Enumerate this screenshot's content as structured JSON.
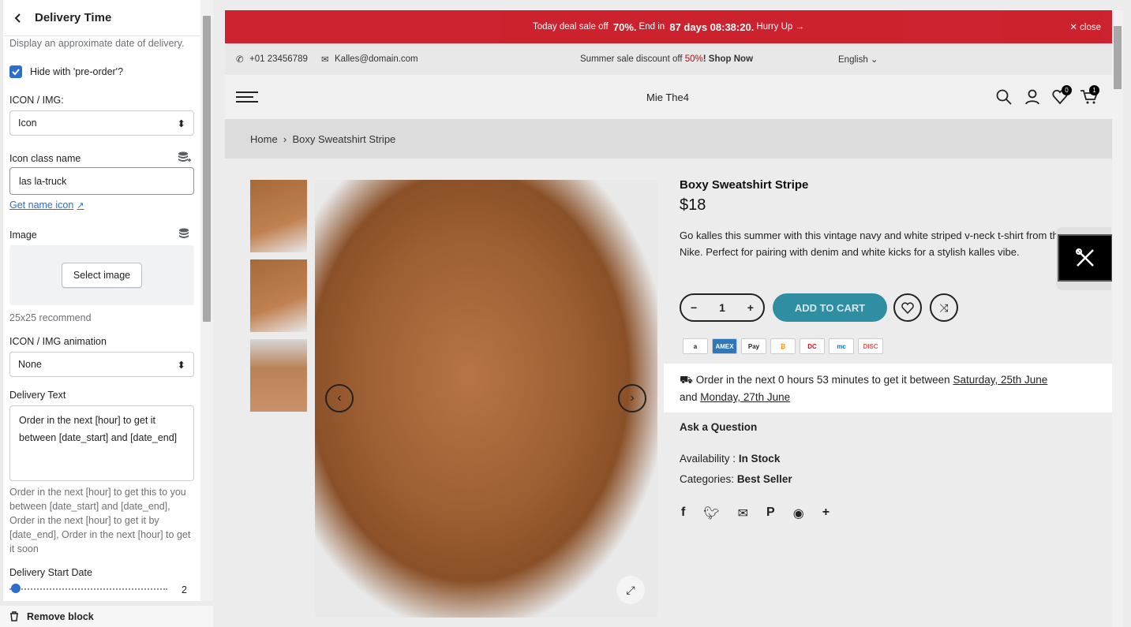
{
  "panel": {
    "title": "Delivery Time",
    "description": "Display an approximate date of delivery.",
    "hide_preorder_label": "Hide with 'pre-order'?",
    "icon_img_label": "ICON / IMG:",
    "icon_img_value": "Icon",
    "icon_class_label": "Icon class name",
    "icon_class_value": "las la-truck",
    "get_name_icon": "Get name icon",
    "image_label": "Image",
    "select_image": "Select image",
    "image_help": "25x25 recommend",
    "animation_label": "ICON / IMG animation",
    "animation_value": "None",
    "delivery_text_label": "Delivery Text",
    "delivery_text_value": "Order in the next [hour] to get it between [date_start] and [date_end]",
    "delivery_help": "Order in the next [hour] to get this to you between [date_start] and [date_end], Order in the next [hour] to get it by [date_end], Order in the next [hour] to get it soon",
    "start_date_label": "Delivery Start Date",
    "start_date_value": "2",
    "remove_block": "Remove block"
  },
  "store": {
    "announcement": {
      "pre": "Today deal sale off",
      "pct": "70%.",
      "mid": "End in",
      "timer": "87 days 08:38:20.",
      "post": "Hurry Up →",
      "close": "✕ close"
    },
    "phone": "+01 23456789",
    "email": "Kalles@domain.com",
    "promo_pre": "Summer sale discount off",
    "promo_pct": "50%",
    "promo_link": "! Shop Now",
    "language": "English ⌄",
    "logo": "Mie The4",
    "wishlist_count": "0",
    "cart_count": "1",
    "breadcrumb_home": "Home",
    "breadcrumb_sep": "›",
    "breadcrumb_current": "Boxy Sweatshirt Stripe",
    "product": {
      "title": "Boxy Sweatshirt Stripe",
      "price": "$18",
      "description": "Go kalles this summer with this vintage navy and white striped v-neck t-shirt from the Nike. Perfect for pairing with denim and white kicks for a stylish kalles vibe.",
      "qty": "1",
      "add_to_cart": "ADD TO CART",
      "delivery_pre": "Order in the next 0 hours 53 minutes to get it between",
      "date_start": "Saturday, 25th June",
      "delivery_and": "and",
      "date_end": "Monday, 27th June",
      "ask": "Ask a Question",
      "availability_label": "Availability :",
      "availability_value": "In Stock",
      "categories_label": "Categories:",
      "categories_value": "Best Seller",
      "payments": [
        "a",
        "AMEX",
        "Pay",
        "₿",
        "DC",
        "mc",
        "DISC"
      ]
    }
  },
  "colors": {
    "accent": "#2c6ecb",
    "announcement": "#c8000f",
    "cart_button": "#2f8ea2"
  }
}
